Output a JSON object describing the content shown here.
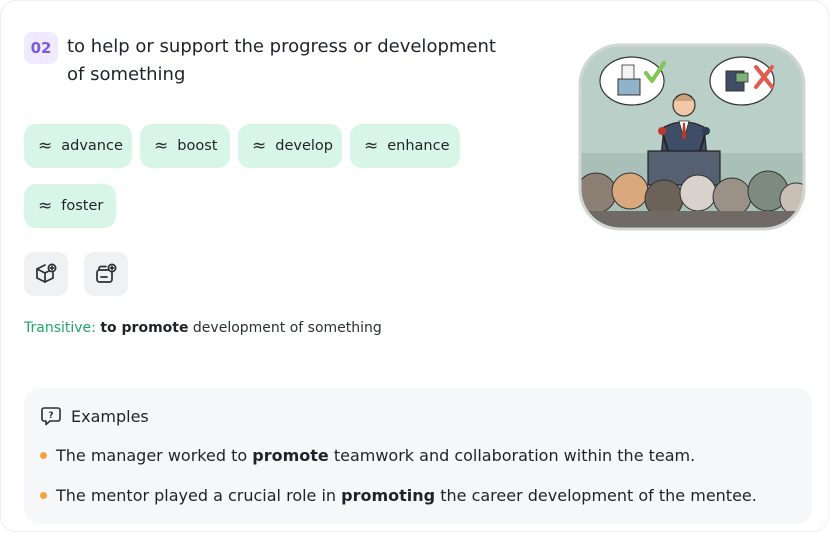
{
  "entry": {
    "number": "02",
    "definition": "to help or support the progress or development of something"
  },
  "synonyms": [
    {
      "symbol": "≈",
      "label": "advance"
    },
    {
      "symbol": "≈",
      "label": "boost"
    },
    {
      "symbol": "≈",
      "label": "develop"
    },
    {
      "symbol": "≈",
      "label": "enhance"
    },
    {
      "symbol": "≈",
      "label": "foster"
    }
  ],
  "actions": [
    {
      "icon": "cube-plus-icon"
    },
    {
      "icon": "wallet-plus-icon"
    }
  ],
  "grammar": {
    "label": "Transitive:",
    "pattern": "to promote",
    "rest": " development of something"
  },
  "examples": {
    "heading": "Examples",
    "items": [
      {
        "before": "The manager worked to ",
        "keyword": "promote",
        "after": " teamwork and collaboration within the team."
      },
      {
        "before": "The mentor played a crucial role in ",
        "keyword": "promoting",
        "after": " the career development of the mentee."
      }
    ]
  },
  "colors": {
    "badge_bg": "#efeaff",
    "badge_text": "#7a5ae0",
    "chip_bg": "#d7f6e8",
    "grammar_label": "#1fa866",
    "bullet": "#f5a13d",
    "check": "#7ec850",
    "cross": "#e25b4b"
  }
}
